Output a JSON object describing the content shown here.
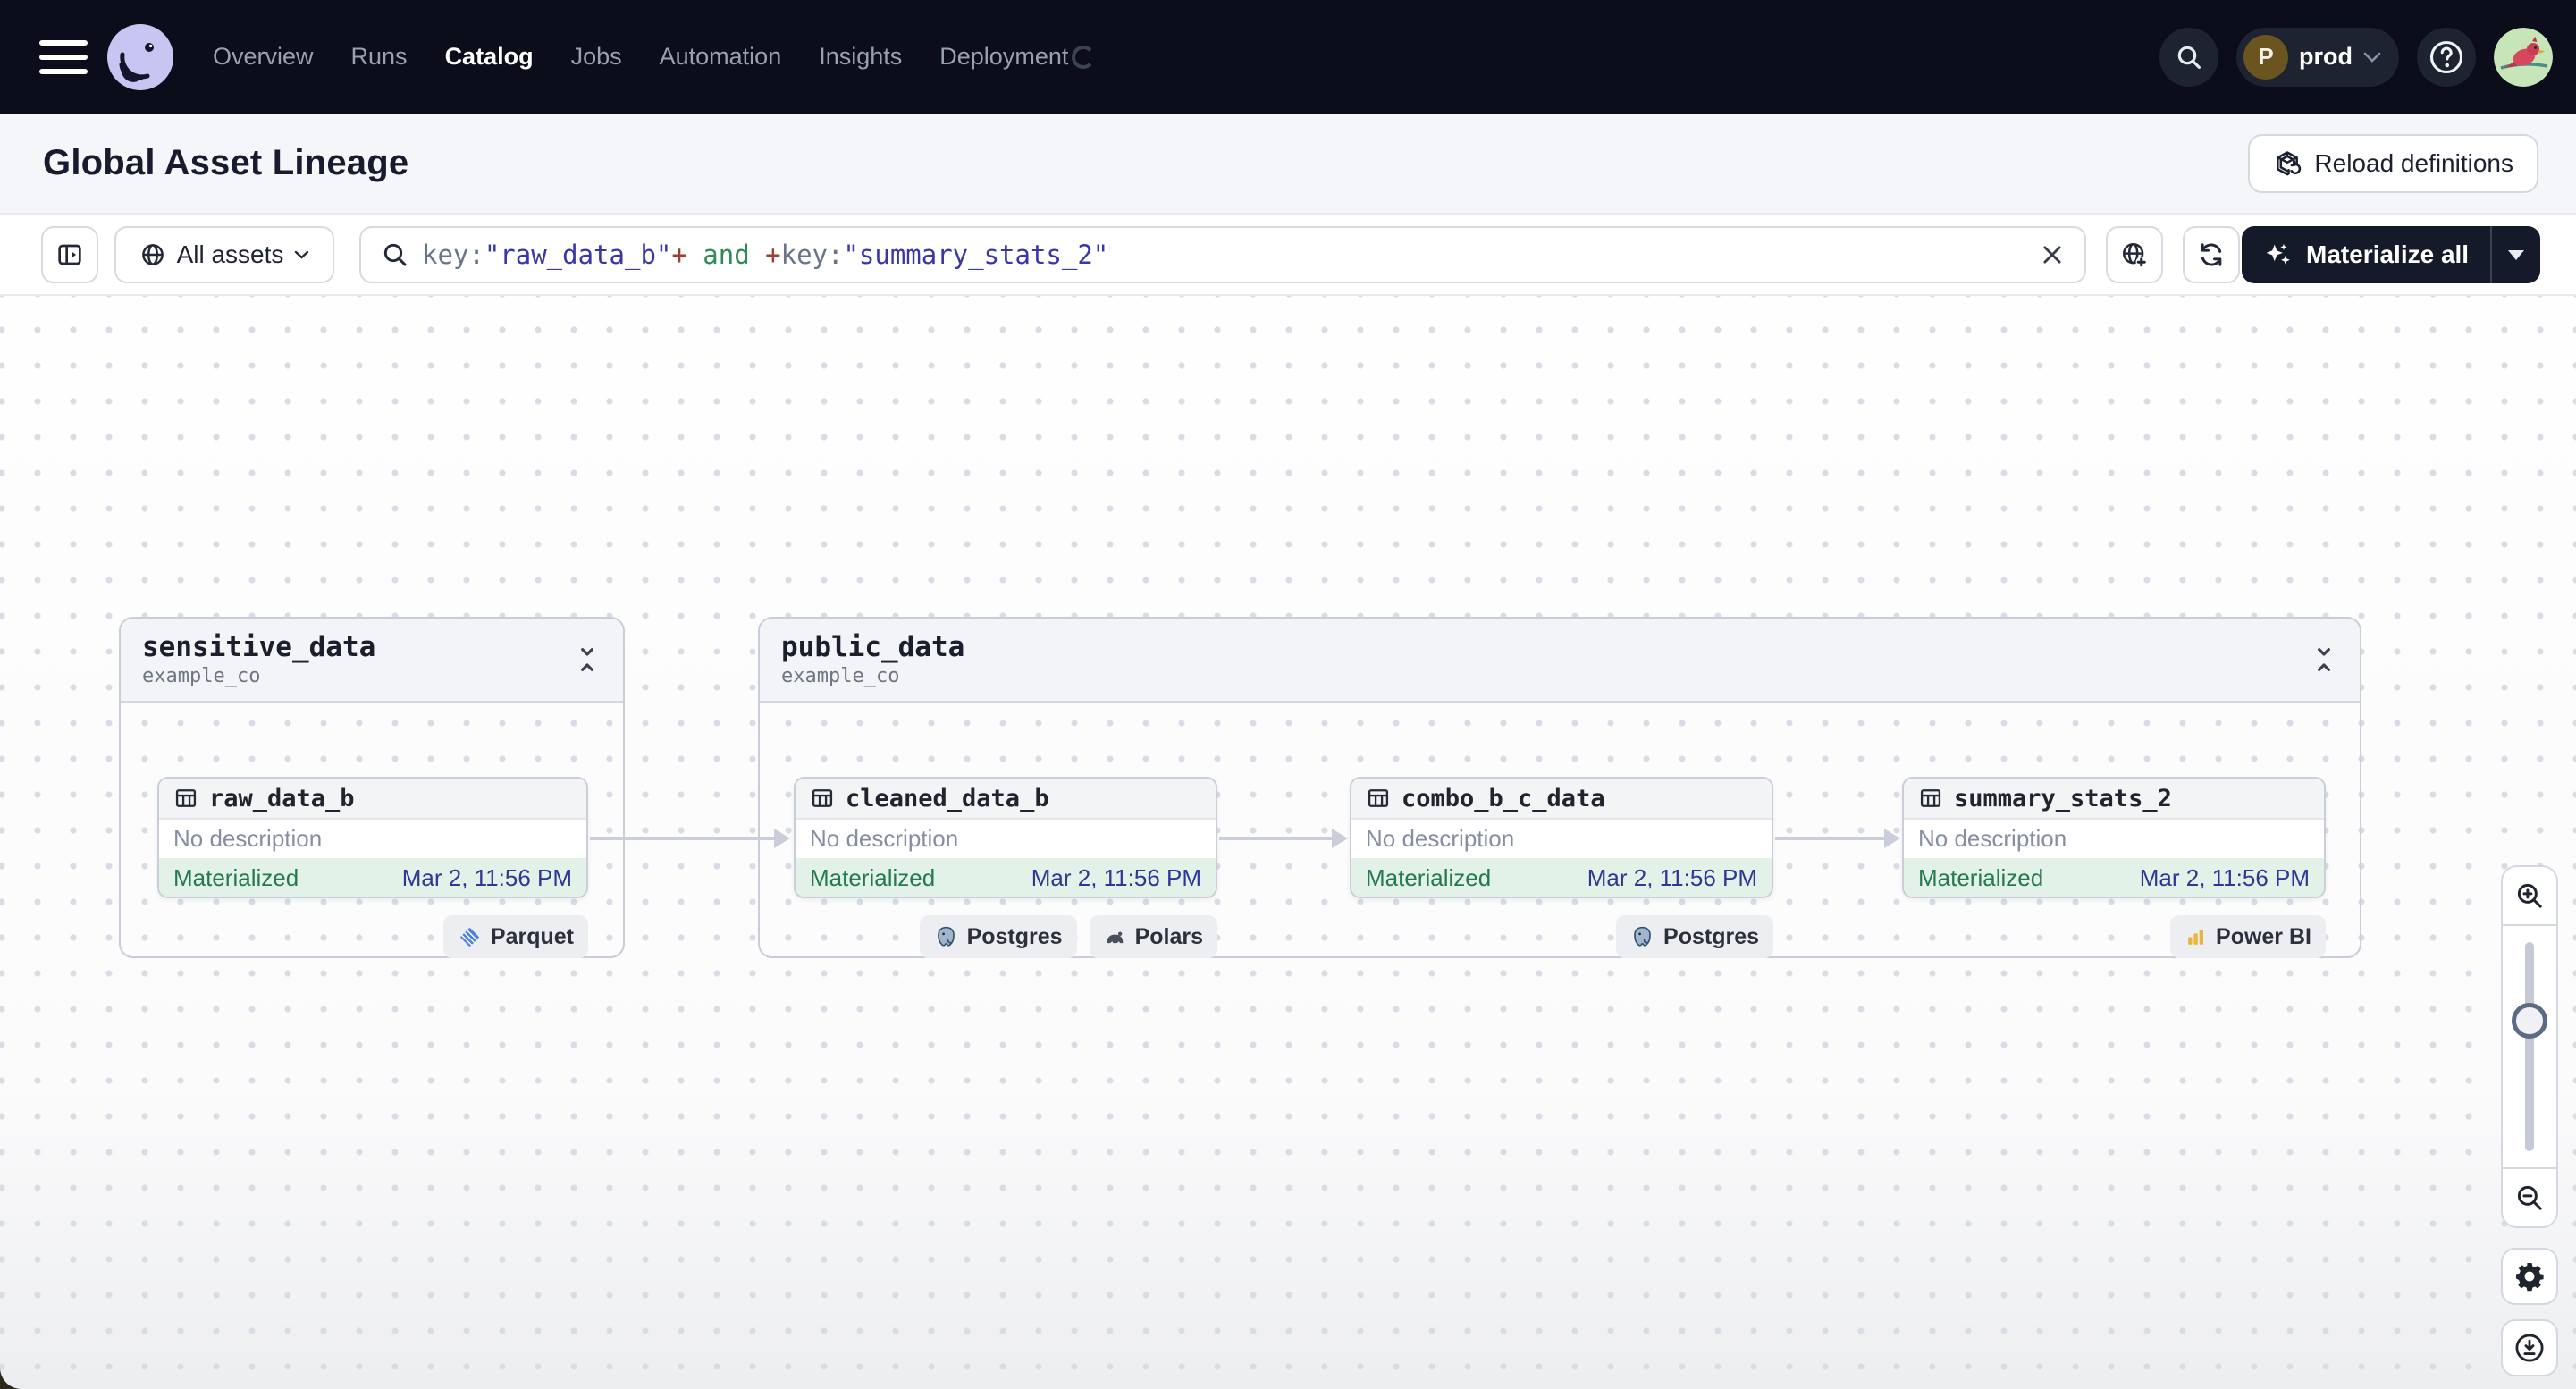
{
  "nav": {
    "items": [
      "Overview",
      "Runs",
      "Catalog",
      "Jobs",
      "Automation",
      "Insights",
      "Deployment"
    ],
    "active": "Catalog",
    "environment": {
      "initial": "P",
      "label": "prod"
    }
  },
  "header": {
    "title": "Global Asset Lineage",
    "reload_button": "Reload definitions"
  },
  "toolbar": {
    "scope_button": "All assets",
    "materialize_button": "Materialize all",
    "search_query": "key:\"raw_data_b\"+ and +key:\"summary_stats_2\"",
    "query_segments": [
      {
        "text": "key:",
        "type": "attr"
      },
      {
        "text": "\"raw_data_b\"",
        "type": "value"
      },
      {
        "text": "+",
        "type": "op"
      },
      {
        "text": " and ",
        "type": "bool"
      },
      {
        "text": "+",
        "type": "op"
      },
      {
        "text": "key:",
        "type": "attr"
      },
      {
        "text": "\"summary_stats_2\"",
        "type": "value"
      }
    ]
  },
  "graph": {
    "groups": [
      {
        "name": "sensitive_data",
        "repo": "example_co",
        "assets": [
          {
            "name": "raw_data_b",
            "description": "No description",
            "status": "Materialized",
            "timestamp": "Mar 2, 11:56 PM",
            "tags": [
              {
                "label": "Parquet",
                "icon": "parquet-icon"
              }
            ]
          }
        ]
      },
      {
        "name": "public_data",
        "repo": "example_co",
        "assets": [
          {
            "name": "cleaned_data_b",
            "description": "No description",
            "status": "Materialized",
            "timestamp": "Mar 2, 11:56 PM",
            "tags": [
              {
                "label": "Postgres",
                "icon": "postgres-icon"
              },
              {
                "label": "Polars",
                "icon": "polars-icon"
              }
            ]
          },
          {
            "name": "combo_b_c_data",
            "description": "No description",
            "status": "Materialized",
            "timestamp": "Mar 2, 11:56 PM",
            "tags": [
              {
                "label": "Postgres",
                "icon": "postgres-icon"
              }
            ]
          },
          {
            "name": "summary_stats_2",
            "description": "No description",
            "status": "Materialized",
            "timestamp": "Mar 2, 11:56 PM",
            "tags": [
              {
                "label": "Power BI",
                "icon": "powerbi-icon"
              }
            ]
          }
        ]
      }
    ]
  },
  "colors": {
    "navbar_bg": "#0B0E1A",
    "button_dark_bg": "#141A29",
    "materialized_bg": "#E3F2E9",
    "materialized_text": "#257A4B",
    "timestamp_text": "#2F3795",
    "query_attr": "#6A7489",
    "query_value": "#3A36A8",
    "query_op": "#A03E2F",
    "query_bool": "#2E8B57",
    "edge_color": "#C9CEDA"
  },
  "icon_map": {
    "menu-icon": "hamburger",
    "dagster-logo": "octopus",
    "search-icon": "magnifier",
    "help-icon": "question-circle",
    "user-avatar": "cardinal-bird",
    "panel-open-icon": "sidebar-expand",
    "globe-icon": "globe",
    "clear-icon": "x",
    "globe-add-icon": "globe-plus",
    "refresh-icon": "sync-arrows",
    "sparkle-icon": "sparkles",
    "caret-down-icon": "filled-triangle",
    "chevron-down-icon": "chevron",
    "table-icon": "grid-table",
    "collapse-icon": "unfold-less",
    "parquet-icon": "striped-diamond",
    "postgres-icon": "elephant",
    "polars-icon": "bear",
    "powerbi-icon": "yellow-bars",
    "zoom-in-icon": "magnifier-plus",
    "zoom-out-icon": "magnifier-minus",
    "settings-icon": "gear",
    "download-icon": "circle-arrow-down",
    "reload-icon": "cube-refresh",
    "loading-spinner-icon": "open-circle"
  }
}
